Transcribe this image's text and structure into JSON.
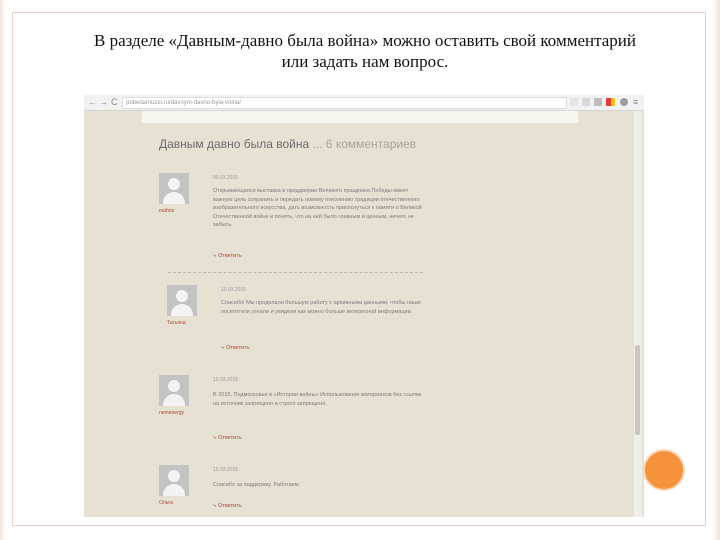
{
  "slide": {
    "title_line1": "В разделе «Давным-давно была война» можно оставить свой комментарий",
    "title_line2": "или задать нам вопрос.",
    "accent_color": "#f6913c"
  },
  "browser": {
    "back_glyph": "←",
    "forward_glyph": "→",
    "reload_glyph": "C",
    "url": "pobedamuzei.ru/davnym-davno-byla-voina/",
    "menu_glyph": "≡"
  },
  "page": {
    "heading": "Давным давно была война",
    "heading_count": "... 6 комментариев",
    "comments": [
      {
        "author": "mahno",
        "date": "09.03.2015",
        "text": "Открывающаяся выставка в преддверии Великого праздника Победы имеет важную цель сохранить и передать новому поколению традиции отечественного изобразительного искусства, дать возможность прикоснуться к памяти о Великой Отечественной войне и понять, что на ней было главным и ценным, ничего не забыть.",
        "reply": "Ответить"
      },
      {
        "author": "Татьяна",
        "date": "10.03.2015",
        "text": "Спасибо! Мы проделали большую работу с архивными данными, чтобы наши посетители узнали и увидели как можно больше интересной информации.",
        "reply": "Ответить"
      },
      {
        "author": "nemenergy",
        "date": "15.03.2015",
        "text": "В 2015, Подмосковье в «Истории войны» Использование материалов без ссылки на источник запрещено и строго запрещено.",
        "reply": "Ответить"
      },
      {
        "author": "Ольга",
        "date": "16.03.2015",
        "text": "Спасибо за поддержку. Работаем.",
        "reply": "Ответить"
      }
    ]
  }
}
